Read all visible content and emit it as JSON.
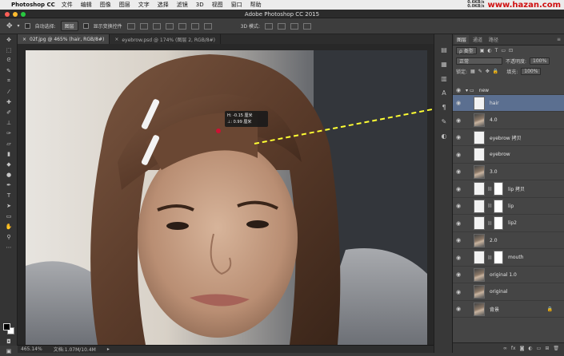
{
  "menubar": {
    "app_name": "Photoshop CC",
    "items": [
      "文件",
      "编辑",
      "图像",
      "图层",
      "文字",
      "选择",
      "滤镜",
      "3D",
      "视图",
      "窗口",
      "帮助"
    ],
    "watermark": "www.hazan.com",
    "net_up": "0.6KB/s",
    "net_down": "0.0KB/s"
  },
  "window": {
    "title": "Adobe Photoshop CC 2015"
  },
  "options": {
    "auto_select_label": "自动选择:",
    "auto_select_value": "图层",
    "transform_label": "显示变换控件",
    "mode_label": "3D 模式:"
  },
  "tabs": [
    {
      "label": "02f.jpg @ 465% (hair, RGB/8#)",
      "close": "×"
    },
    {
      "label": "eyebrow.psd @ 174% (图层 2, RGB/8#)",
      "close": "×"
    }
  ],
  "info_popup": {
    "line1": "H: -0.15 厘米",
    "line2": "⊥: 0.99 厘米"
  },
  "status": {
    "zoom": "465.14%",
    "doc": "文档:1.07M/10.4M"
  },
  "layers_panel": {
    "tabs": [
      "图层",
      "通道",
      "路径"
    ],
    "kind_label": "ρ 类型",
    "blend_mode": "正常",
    "opacity_label": "不透明度:",
    "opacity_value": "100%",
    "lock_label": "锁定:",
    "fill_label": "填充:",
    "fill_value": "100%",
    "group_name": "new",
    "layers": [
      {
        "name": "hair",
        "thumb": "white",
        "mask": false
      },
      {
        "name": "4.0",
        "thumb": "face",
        "mask": false
      },
      {
        "name": "eyebrow 拷贝",
        "thumb": "white",
        "mask": false
      },
      {
        "name": "eyebrow",
        "thumb": "white",
        "mask": false
      },
      {
        "name": "3.0",
        "thumb": "face",
        "mask": false
      },
      {
        "name": "lip 拷贝",
        "thumb": "white",
        "mask": true
      },
      {
        "name": "lip",
        "thumb": "white",
        "mask": true
      },
      {
        "name": "lip2",
        "thumb": "white",
        "mask": true
      },
      {
        "name": "2.0",
        "thumb": "face",
        "mask": false
      },
      {
        "name": "mouth",
        "thumb": "white",
        "mask": true
      },
      {
        "name": "original 1.0",
        "thumb": "face",
        "mask": false
      },
      {
        "name": "original",
        "thumb": "face",
        "mask": false
      },
      {
        "name": "背景",
        "thumb": "face",
        "mask": false
      }
    ],
    "bottom_icons": [
      "link-icon",
      "fx-icon",
      "mask-icon",
      "adjustment-icon",
      "folder-icon",
      "new-layer-icon",
      "trash-icon"
    ]
  },
  "colors": {
    "highlight": "#ffff33",
    "selected_layer": "#5b6f90",
    "info_dot": "#cc1133"
  }
}
